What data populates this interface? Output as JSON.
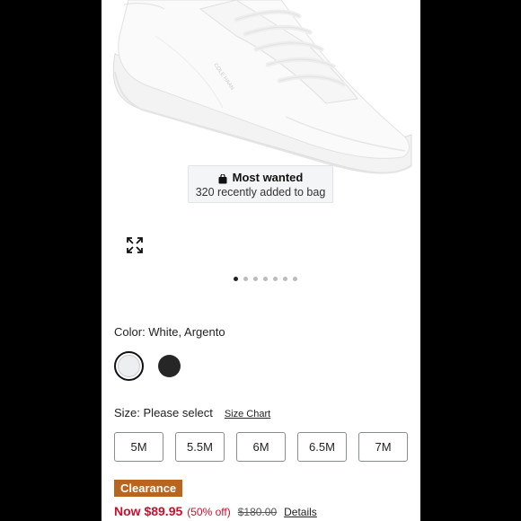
{
  "image": {
    "badge_title": "Most wanted",
    "badge_sub": "320 recently added to bag",
    "brand_mark": "COLE HAAN",
    "carousel": {
      "total": 7,
      "active_index": 0
    }
  },
  "color": {
    "label": "Color: White, Argento",
    "swatches": [
      {
        "name": "white",
        "hex": "#eceef0",
        "selected": true
      },
      {
        "name": "black",
        "hex": "#262626",
        "selected": false
      }
    ]
  },
  "size": {
    "label": "Size: Please select",
    "chart_link": "Size Chart",
    "options": [
      "5M",
      "5.5M",
      "6M",
      "6.5M",
      "7M"
    ]
  },
  "price": {
    "clearance_badge": "Clearance",
    "now": "Now $89.95",
    "percent_off": "(50% off)",
    "original": "$180.00",
    "details_link": "Details"
  },
  "colors": {
    "sale_red": "#c8102e",
    "clearance_bg": "#b8661f"
  }
}
